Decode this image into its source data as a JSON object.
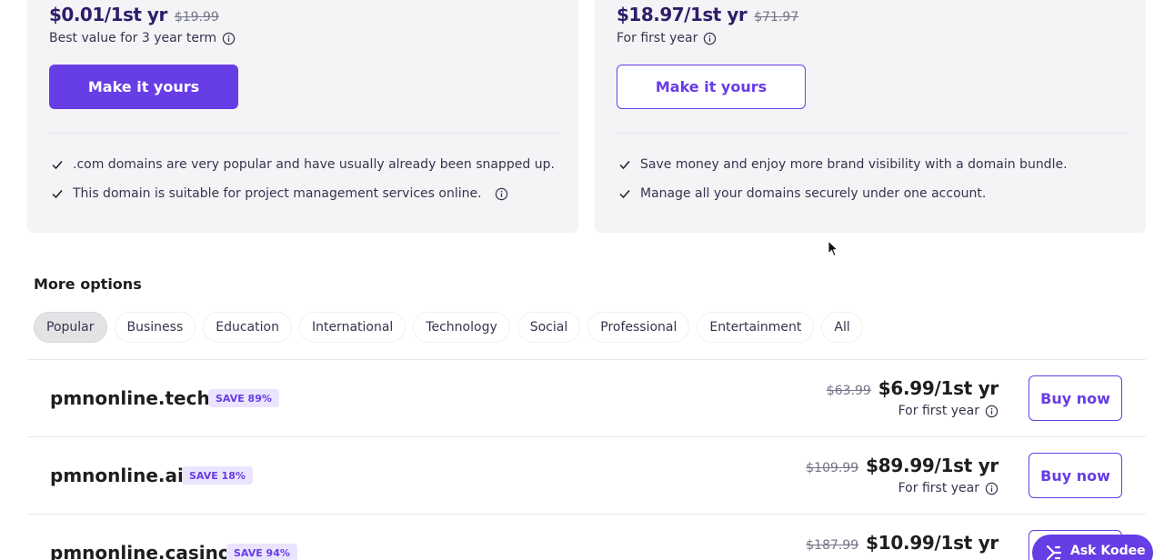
{
  "plans": [
    {
      "price": "$0.01/1st yr",
      "old_price": "$19.99",
      "note": "Best value for 3 year term",
      "button": "Make it yours",
      "features": [
        ".com domains are very popular and have usually already been snapped up.",
        "This domain is suitable for project management services online."
      ]
    },
    {
      "price": "$18.97/1st yr",
      "old_price": "$71.97",
      "note": "For first year",
      "button": "Make it yours",
      "features": [
        "Save money and enjoy more brand visibility with a domain bundle.",
        "Manage all your domains securely under one account."
      ]
    }
  ],
  "more_options": {
    "title": "More options",
    "tabs": [
      "Popular",
      "Business",
      "Education",
      "International",
      "Technology",
      "Social",
      "Professional",
      "Entertainment",
      "All"
    ],
    "active_tab": "Popular"
  },
  "domains": [
    {
      "name": "pmnonline.tech",
      "badge": "SAVE 89%",
      "old_price": "$63.99",
      "price": "$6.99/1st yr",
      "note": "For first year",
      "button": "Buy now"
    },
    {
      "name": "pmnonline.ai",
      "badge": "SAVE 18%",
      "old_price": "$109.99",
      "price": "$89.99/1st yr",
      "note": "For first year",
      "button": "Buy now"
    },
    {
      "name": "pmnonline.casino",
      "badge": "SAVE 94%",
      "old_price": "$187.99",
      "price": "$10.99/1st yr",
      "note": "",
      "button": ""
    }
  ],
  "assistant": {
    "label": "Ask Kodee"
  },
  "colors": {
    "brand": "#673de6",
    "price_dark": "#2f1c6a",
    "card_bg": "#f4f4f7"
  },
  "icons": [
    "info-icon",
    "check-icon",
    "kodee-icon",
    "mouse-cursor-icon"
  ]
}
